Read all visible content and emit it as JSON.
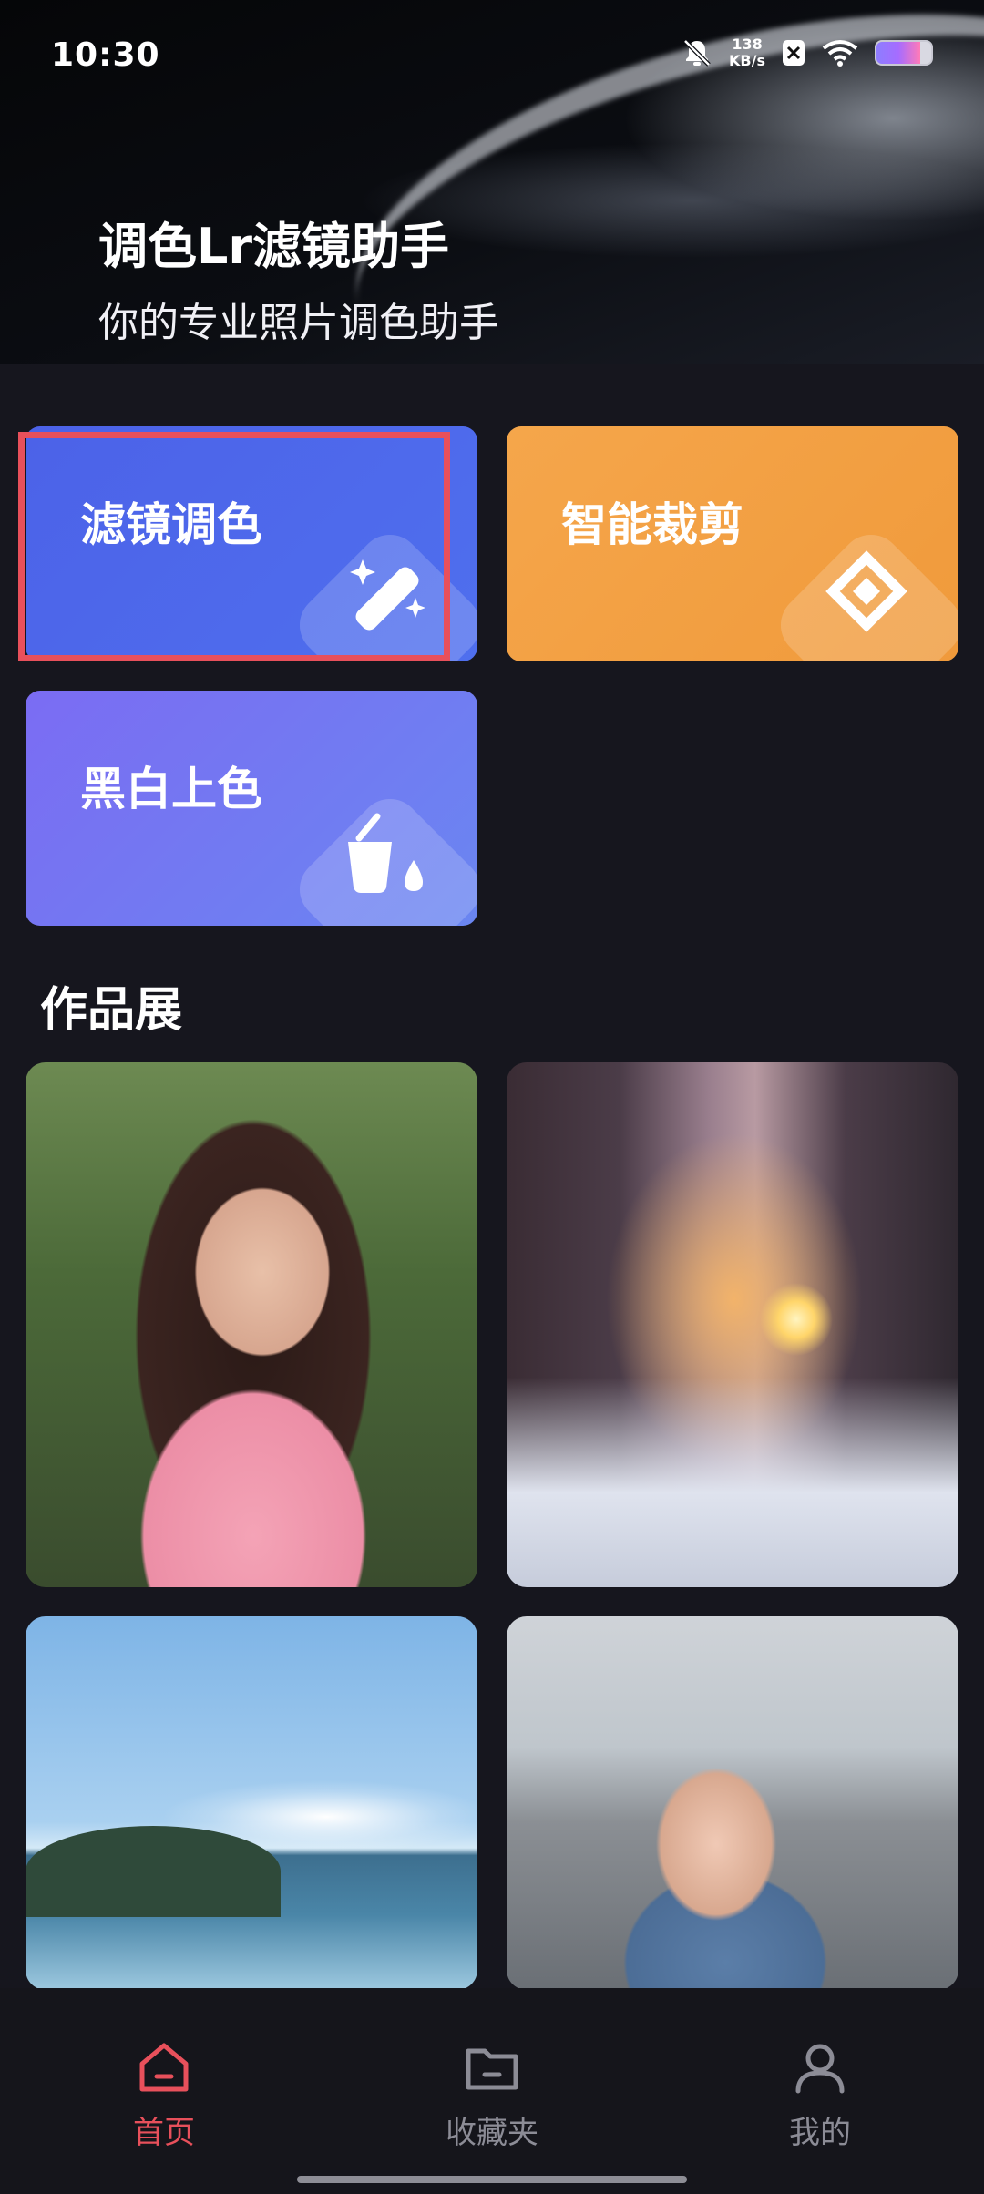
{
  "status_bar": {
    "time": "10:30",
    "net_speed_value": "138",
    "net_speed_unit": "KB/s"
  },
  "header": {
    "title": "调色Lr滤镜助手",
    "subtitle": "你的专业照片调色助手"
  },
  "features": [
    {
      "label": "滤镜调色",
      "icon": "magic-wand-icon",
      "color": "#4c62e8"
    },
    {
      "label": "智能裁剪",
      "icon": "crop-icon",
      "color": "#f5a64b"
    },
    {
      "label": "黑白上色",
      "icon": "paint-bucket-icon",
      "color": "#7b6cf3"
    }
  ],
  "gallery": {
    "title": "作品展"
  },
  "bottom_nav": {
    "items": [
      {
        "label": "首页",
        "icon": "home-icon",
        "active": true
      },
      {
        "label": "收藏夹",
        "icon": "folder-icon",
        "active": false
      },
      {
        "label": "我的",
        "icon": "user-icon",
        "active": false
      }
    ]
  },
  "colors": {
    "accent_active": "#e8505b",
    "nav_inactive": "#8c8c96",
    "background": "#16161e"
  }
}
